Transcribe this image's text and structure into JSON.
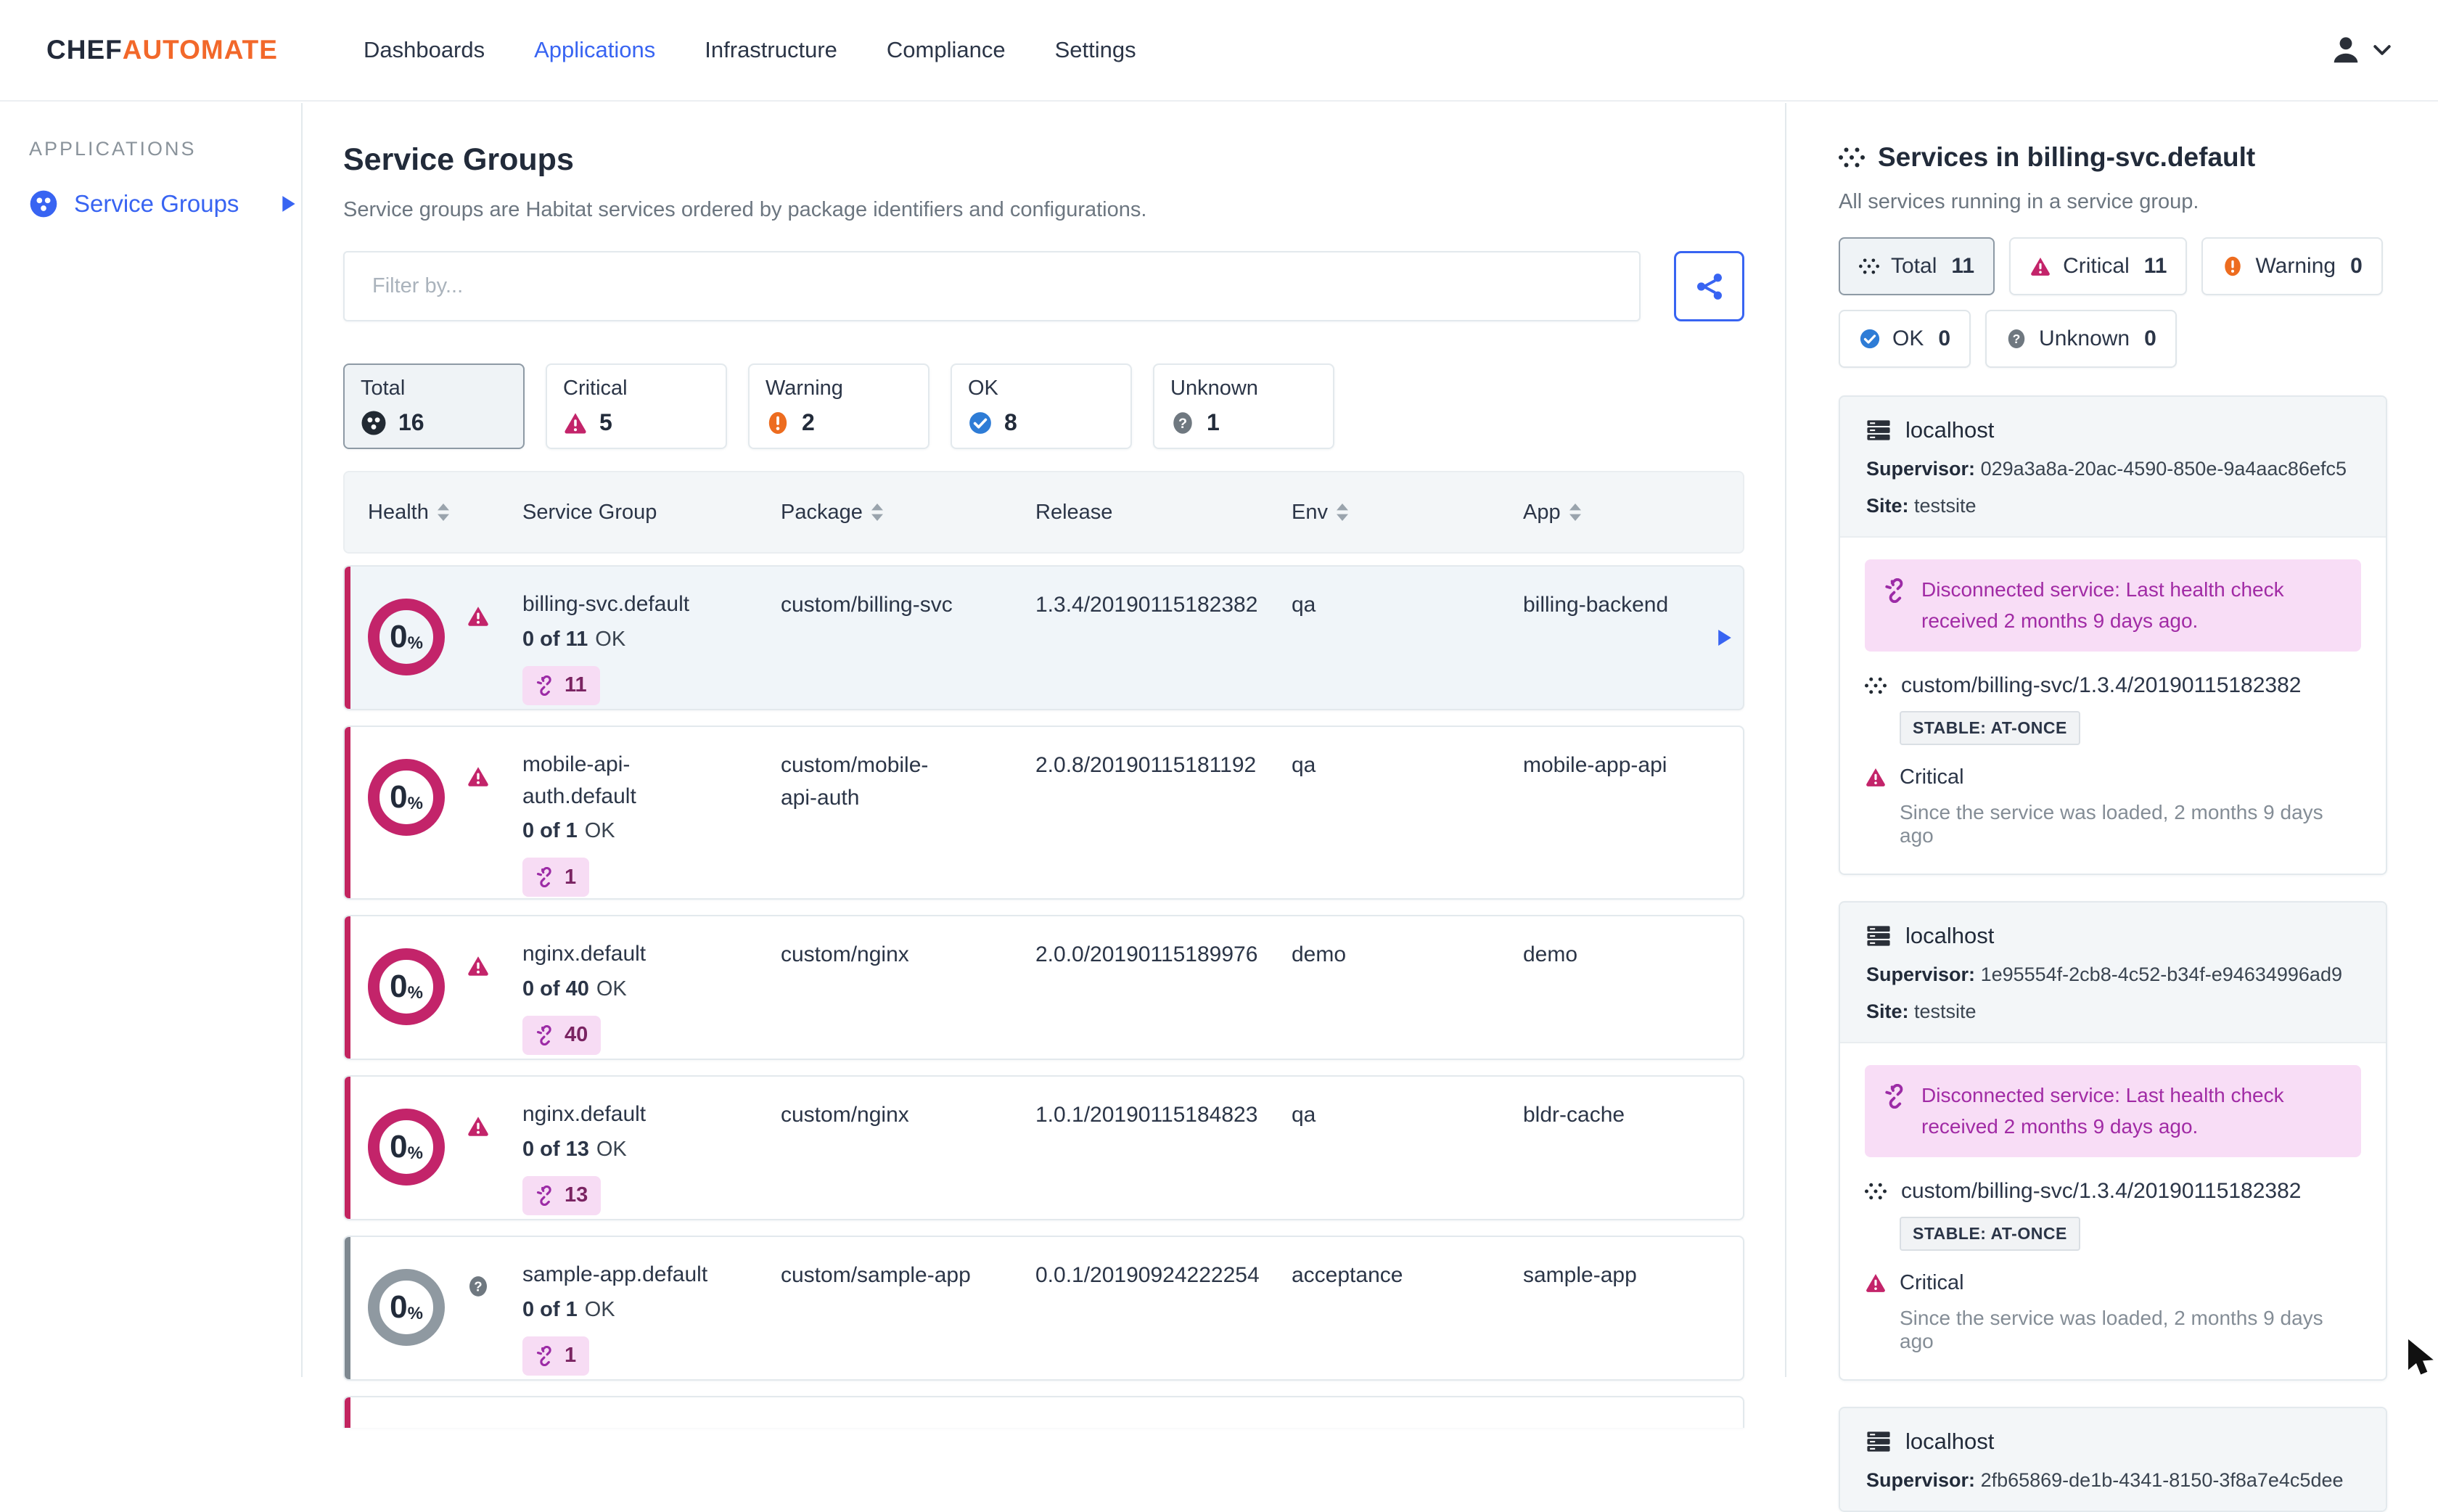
{
  "brand": {
    "chef": "CHEF",
    "automate": "AUTOMATE"
  },
  "nav": {
    "items": [
      {
        "label": "Dashboards",
        "active": false
      },
      {
        "label": "Applications",
        "active": true
      },
      {
        "label": "Infrastructure",
        "active": false
      },
      {
        "label": "Compliance",
        "active": false
      },
      {
        "label": "Settings",
        "active": false
      }
    ]
  },
  "sidebar": {
    "heading": "APPLICATIONS",
    "items": [
      {
        "label": "Service Groups",
        "active": true
      }
    ]
  },
  "main": {
    "title": "Service Groups",
    "subtitle": "Service groups are Habitat services ordered by package identifiers and configurations.",
    "filter_placeholder": "Filter by...",
    "status_filters": [
      {
        "label": "Total",
        "count": 16,
        "selected": true
      },
      {
        "label": "Critical",
        "count": 5,
        "selected": false
      },
      {
        "label": "Warning",
        "count": 2,
        "selected": false
      },
      {
        "label": "OK",
        "count": 8,
        "selected": false
      },
      {
        "label": "Unknown",
        "count": 1,
        "selected": false
      }
    ],
    "table": {
      "columns": [
        {
          "label": "Health",
          "sortable": true
        },
        {
          "label": "Service Group",
          "sortable": false
        },
        {
          "label": "Package",
          "sortable": true
        },
        {
          "label": "Release",
          "sortable": false
        },
        {
          "label": "Env",
          "sortable": true
        },
        {
          "label": "App",
          "sortable": true
        }
      ],
      "rows": [
        {
          "health_percent": 0,
          "status": "critical",
          "service_group": "billing-svc.default",
          "ok_bold": "0 of 11",
          "ok_suffix": "OK",
          "disconnected_count": 11,
          "package": "custom/billing-svc",
          "release": "1.3.4/20190115182382",
          "env": "qa",
          "app": "billing-backend",
          "selected": true
        },
        {
          "health_percent": 0,
          "status": "critical",
          "service_group": "mobile-api-auth.default",
          "ok_bold": "0 of 1",
          "ok_suffix": "OK",
          "disconnected_count": 1,
          "package": "custom/mobile-api-auth",
          "release": "2.0.8/20190115181192",
          "env": "qa",
          "app": "mobile-app-api",
          "selected": false
        },
        {
          "health_percent": 0,
          "status": "critical",
          "service_group": "nginx.default",
          "ok_bold": "0 of 40",
          "ok_suffix": "OK",
          "disconnected_count": 40,
          "package": "custom/nginx",
          "release": "2.0.0/20190115189976",
          "env": "demo",
          "app": "demo",
          "selected": false
        },
        {
          "health_percent": 0,
          "status": "critical",
          "service_group": "nginx.default",
          "ok_bold": "0 of 13",
          "ok_suffix": "OK",
          "disconnected_count": 13,
          "package": "custom/nginx",
          "release": "1.0.1/20190115184823",
          "env": "qa",
          "app": "bldr-cache",
          "selected": false
        },
        {
          "health_percent": 0,
          "status": "unknown",
          "service_group": "sample-app.default",
          "ok_bold": "0 of 1",
          "ok_suffix": "OK",
          "disconnected_count": 1,
          "package": "custom/sample-app",
          "release": "0.0.1/20190924222254",
          "env": "acceptance",
          "app": "sample-app",
          "selected": false
        }
      ]
    }
  },
  "panel": {
    "title": "Services in billing-svc.default",
    "subtitle": "All services running in a service group.",
    "status_filters": [
      {
        "label": "Total",
        "count": 11,
        "selected": true
      },
      {
        "label": "Critical",
        "count": 11,
        "selected": false
      },
      {
        "label": "Warning",
        "count": 0,
        "selected": false
      },
      {
        "label": "OK",
        "count": 0,
        "selected": false
      },
      {
        "label": "Unknown",
        "count": 0,
        "selected": false
      }
    ],
    "cards": [
      {
        "host": "localhost",
        "supervisor_label": "Supervisor:",
        "supervisor_id": "029a3a8a-20ac-4590-850e-9a4aac86efc5",
        "site_label": "Site:",
        "site": "testsite",
        "alert": "Disconnected service: Last health check received 2 months 9 days ago.",
        "package": "custom/billing-svc/1.3.4/20190115182382",
        "badge": "STABLE: AT-ONCE",
        "health_label": "Critical",
        "since": "Since the service was loaded, 2 months 9 days ago"
      },
      {
        "host": "localhost",
        "supervisor_label": "Supervisor:",
        "supervisor_id": "1e95554f-2cb8-4c52-b34f-e94634996ad9",
        "site_label": "Site:",
        "site": "testsite",
        "alert": "Disconnected service: Last health check received 2 months 9 days ago.",
        "package": "custom/billing-svc/1.3.4/20190115182382",
        "badge": "STABLE: AT-ONCE",
        "health_label": "Critical",
        "since": "Since the service was loaded, 2 months 9 days ago"
      },
      {
        "host": "localhost",
        "supervisor_label": "Supervisor:",
        "supervisor_id": "2fb65869-de1b-4341-8150-3f8a7e4c5dee"
      }
    ]
  },
  "strings": {
    "percent": "%"
  },
  "colors": {
    "accent_blue": "#3864f2",
    "critical_pink": "#c3246a",
    "warning_orange": "#ed6c1f",
    "ok_blue": "#2e7cd6",
    "unknown_gray": "#6f7880",
    "alert_purple": "#a12ba5",
    "alert_bg": "#f8ddf6",
    "header_bg": "#f3f6f8",
    "selected_row_bg": "#f0f5f9",
    "border": "#e3e9ed",
    "brand_orange": "#f2682a"
  }
}
